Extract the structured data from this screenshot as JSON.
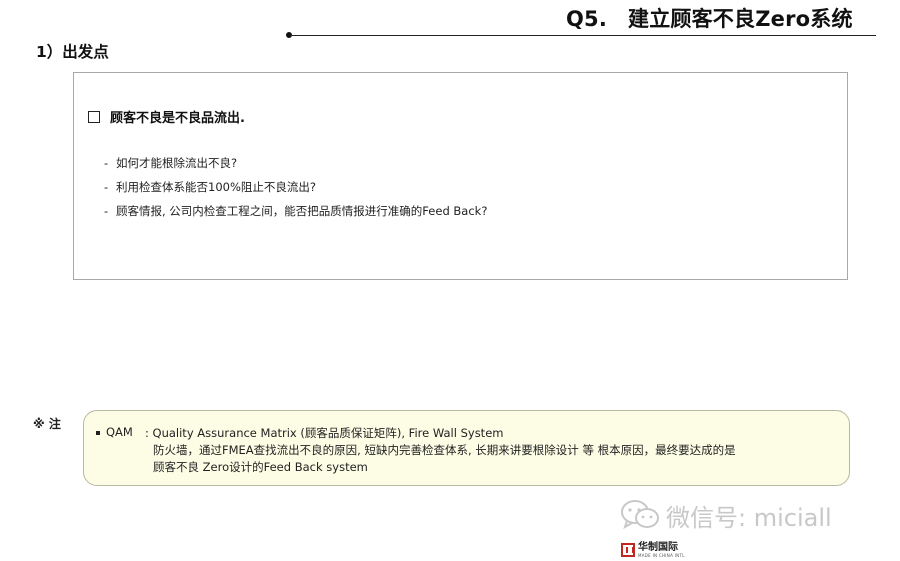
{
  "header": {
    "number": "Q5.",
    "title": "建立顾客不良Zero系统"
  },
  "section": {
    "label": "1）出发点"
  },
  "box": {
    "heading": "顾客不良是不良品流出.",
    "bullets": [
      "如何才能根除流出不良?",
      "利用检查体系能否100%阻止不良流出?",
      "顾客情报, 公司内检查工程之间，能否把品质情报进行准确的Feed Back?"
    ]
  },
  "note": {
    "marker": "※ 注",
    "label": "QAM",
    "lines": [
      ": Quality Assurance Matrix (顾客品质保证矩阵), Fire Wall System",
      "防火墙，通过FMEA查找流出不良的原因, 短缺内完善检查体系, 长期来讲要根除设计 等 根本原因，最终要达成的是",
      "顾客不良 Zero设计的Feed Back system"
    ]
  },
  "watermark": {
    "text": "微信号: miciall",
    "icon": "wechat-icon"
  },
  "brand": {
    "name_cn": "华制国际",
    "name_en": "MADE IN CHINA INTL",
    "color": "#c0271f"
  }
}
